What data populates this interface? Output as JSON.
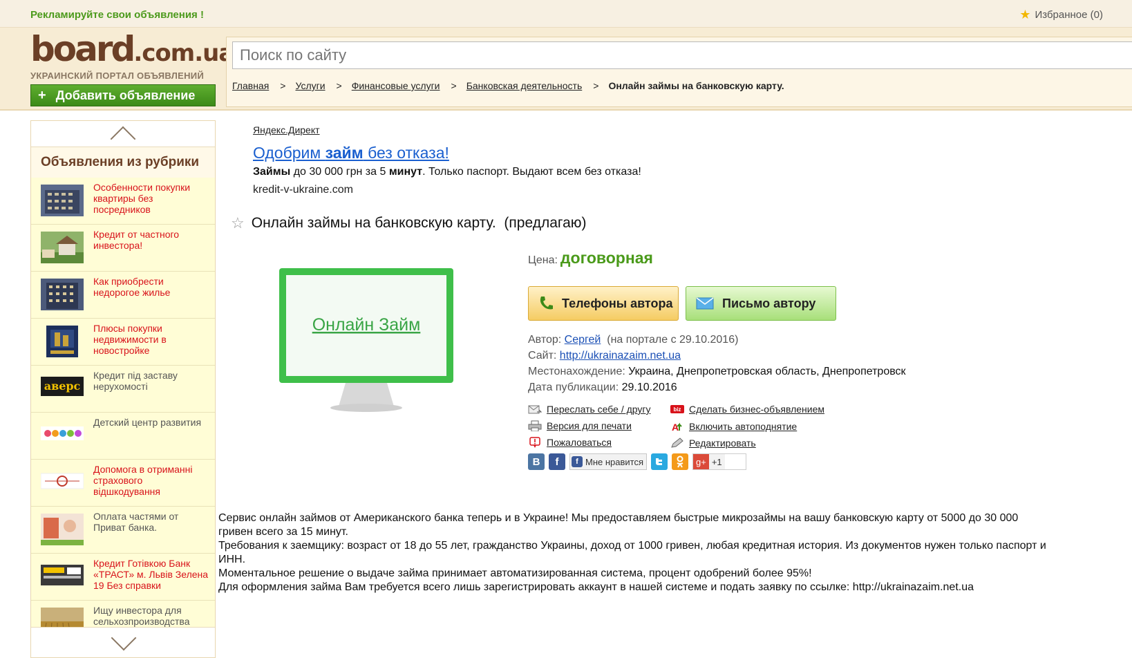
{
  "topbar": {
    "promo": "Рекламируйте свои объявления !",
    "favorites": "Избранное (0)"
  },
  "header": {
    "logo_main": "board",
    "logo_domain": ".com.ua",
    "logo_tagline": "УКРАИНСКИЙ ПОРТАЛ ОБЪЯВЛЕНИЙ",
    "add_button": "Добавить объявление",
    "search_placeholder": "Поиск по сайту",
    "breadcrumbs": [
      "Главная",
      "Услуги",
      "Финансовые услуги",
      "Банковская деятельность"
    ],
    "breadcrumb_sep": ">",
    "breadcrumb_current": "Онлайн займы на банковскую карту."
  },
  "sidebar": {
    "title": "Объявления из рубрики",
    "items": [
      {
        "text": "Особенности покупки квартиры без посредников",
        "color": "#d8121a"
      },
      {
        "text": "Кредит от частного инвестора!",
        "color": "#d8121a"
      },
      {
        "text": "Как приобрести недорогое жилье",
        "color": "#d8121a"
      },
      {
        "text": "Плюсы покупки недвижимости в новостройке",
        "color": "#d8121a"
      },
      {
        "text": "Кредит під заставу нерухомості",
        "color": "#555555"
      },
      {
        "text": "Детский центр развития",
        "color": "#555555"
      },
      {
        "text": "Допомога в отриманні страхового відшкодування",
        "color": "#d8121a"
      },
      {
        "text": "Оплата частями от Приват банка.",
        "color": "#555555"
      },
      {
        "text": "Кредит Готівкою Банк «ТРАСТ» м. Львів Зелена 19 Без справки",
        "color": "#d8121a"
      },
      {
        "text": "Ищу инвестора для сельхозпроизводства",
        "color": "#555555"
      }
    ],
    "thumb_labels": {
      "avers": "аверс"
    }
  },
  "ad": {
    "label": "Яндекс.Директ",
    "title_pre": "Одобрим ",
    "title_bold": "займ",
    "title_post": " без отказа!",
    "text_b1": "Займы",
    "text_1": " до 30 000 грн за 5 ",
    "text_b2": "минут",
    "text_2": ". Только паспорт. Выдают всем без отказа!",
    "url": "kredit-v-ukraine.com"
  },
  "post": {
    "title": "Онлайн займы на банковскую карту.  (предлагаю)",
    "image_text": "Онлайн Займ",
    "price_label": "Цена:",
    "price_value": "договорная",
    "phone_button": "Телефоны автора",
    "mail_button": "Письмо автору",
    "author_label": "Автор:",
    "author_name": "Сергей",
    "author_since": "(на портале с 29.10.2016)",
    "site_label": "Сайт:",
    "site_url": "http://ukrainazaim.net.ua",
    "location_label": "Местонахождение:",
    "location": "Украина, Днепропетровская область, Днепропетровск",
    "date_label": "Дата публикации:",
    "date": "29.10.2016",
    "actions": {
      "forward": "Переслать себе / другу",
      "print": "Версия для печати",
      "complain": "Пожаловаться",
      "business": "Сделать бизнес-объявлением",
      "autoup": "Включить автоподнятие",
      "edit": "Редактировать"
    },
    "social": {
      "vk": "В",
      "fb": "f",
      "like": "Мне нравится",
      "gplus": "g+",
      "gplus_count": "+1",
      "ok": "ок"
    },
    "description": [
      "Сервис онлайн займов от Американского банка теперь и в Украине! Мы предоставляем быстрые микрозаймы на вашу банковскую карту от 5000 до 30 000 гривен всего за 15 минут.",
      "Требования к заемщику: возраст от 18 до 55 лет, гражданство Украины, доход от 1000 гривен, любая кредитная история. Из документов нужен только паспорт и ИНН.",
      "Моментальное решение о выдаче займа принимает автоматизированная система, процент одобрений более 95%!",
      "Для оформления займа Вам требуется всего лишь зарегистрировать аккаунт в нашей системе и подать заявку по ссылке: http://ukrainazaim.net.ua"
    ]
  },
  "colors": {
    "green": "#4a9a1a",
    "red_link": "#d8121a",
    "brown": "#6b3f26",
    "link_blue": "#1a5fcf"
  }
}
